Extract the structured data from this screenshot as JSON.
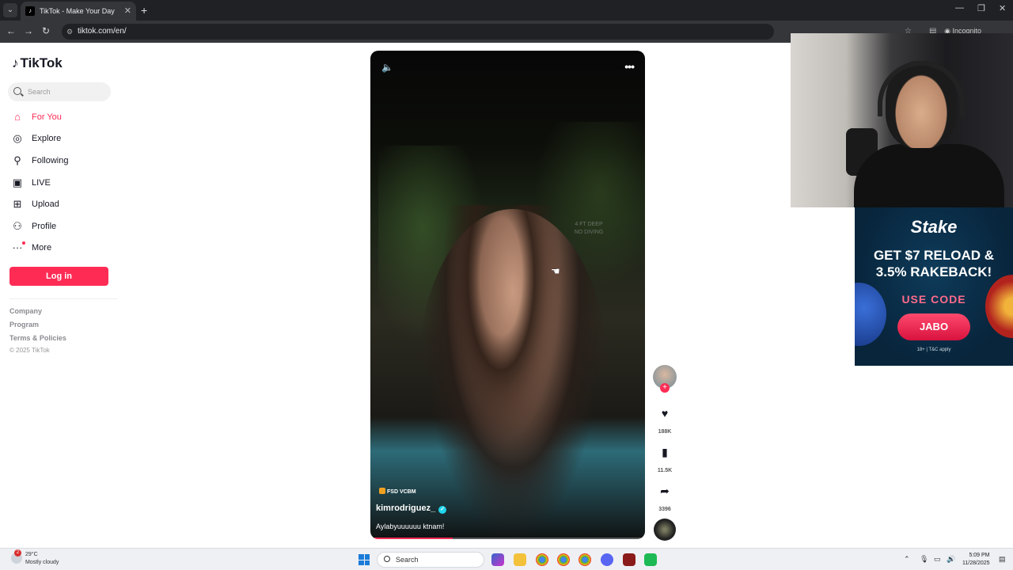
{
  "browser": {
    "tab_title": "TikTok - Make Your Day",
    "url": "tiktok.com/en/",
    "incognito_label": "Incognito"
  },
  "sidebar": {
    "logo": "TikTok",
    "search_placeholder": "Search",
    "nav": [
      {
        "label": "For You",
        "icon": "home-icon",
        "active": true
      },
      {
        "label": "Explore",
        "icon": "compass-icon"
      },
      {
        "label": "Following",
        "icon": "following-icon"
      },
      {
        "label": "LIVE",
        "icon": "live-icon"
      },
      {
        "label": "Upload",
        "icon": "upload-icon"
      },
      {
        "label": "Profile",
        "icon": "profile-icon"
      },
      {
        "label": "More",
        "icon": "more-icon"
      }
    ],
    "login_label": "Log in",
    "footer": {
      "company": "Company",
      "program": "Program",
      "terms": "Terms & Policies",
      "copyright": "© 2025 TikTok"
    }
  },
  "video": {
    "badge": "FSD VCBM",
    "author": "kimrodriguez_",
    "caption": "Aylabyuuuuuu ktnam!",
    "sign_text": "4 FT DEEP NO DIVING",
    "progress": 0.3
  },
  "actions": {
    "likes": "188K",
    "saves": "11.5K",
    "shares": "3396"
  },
  "ad": {
    "brand": "Stake",
    "headline_1": "GET $7 RELOAD &",
    "headline_2": "3.5% RAKEBACK!",
    "use_code": "USE CODE",
    "code": "JABO",
    "terms": "18+ | T&C apply"
  },
  "taskbar": {
    "temperature": "29°C",
    "weather": "Mostly cloudy",
    "weather_badge": "2",
    "search": "Search",
    "time": "5:09 PM",
    "date": "11/28/2025"
  },
  "colors": {
    "accent": "#fe2c55",
    "verified": "#20d5ec"
  }
}
